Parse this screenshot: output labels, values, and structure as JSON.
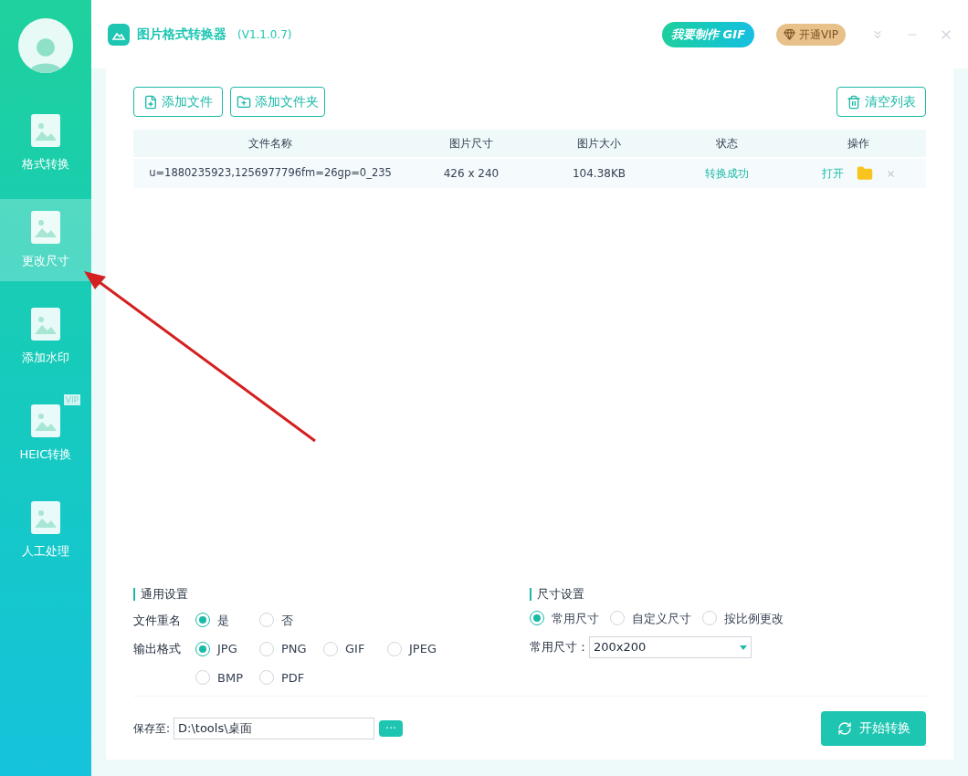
{
  "app": {
    "title": "图片格式转换器",
    "version": "(V1.1.0.7)"
  },
  "header": {
    "gif_button": "我要制作 GIF",
    "vip_button": "开通VIP"
  },
  "sidebar": {
    "items": [
      {
        "label": "格式转换",
        "selected": false
      },
      {
        "label": "更改尺寸",
        "selected": true
      },
      {
        "label": "添加水印",
        "selected": false
      },
      {
        "label": "HEIC转换",
        "selected": false,
        "badge": "VIP"
      },
      {
        "label": "人工处理",
        "selected": false
      }
    ]
  },
  "toolbar": {
    "add_file": "添加文件",
    "add_folder": "添加文件夹",
    "clear": "清空列表"
  },
  "table": {
    "columns": [
      "文件名称",
      "图片尺寸",
      "图片大小",
      "状态",
      "操作"
    ],
    "rows": [
      {
        "name": "u=1880235923,1256977796fm=26gp=0_235",
        "size": "426 x 240",
        "filesize": "104.38KB",
        "status": "转换成功",
        "open": "打开"
      }
    ]
  },
  "general_settings": {
    "title": "通用设置",
    "rename": {
      "label": "文件重名",
      "options": [
        {
          "label": "是",
          "selected": true
        },
        {
          "label": "否",
          "selected": false
        }
      ]
    },
    "format": {
      "label": "输出格式",
      "options": [
        {
          "label": "JPG",
          "selected": true
        },
        {
          "label": "PNG",
          "selected": false
        },
        {
          "label": "GIF",
          "selected": false
        },
        {
          "label": "JPEG",
          "selected": false
        },
        {
          "label": "BMP",
          "selected": false
        },
        {
          "label": "PDF",
          "selected": false
        }
      ]
    }
  },
  "size_settings": {
    "title": "尺寸设置",
    "modes": [
      {
        "label": "常用尺寸",
        "selected": true
      },
      {
        "label": "自定义尺寸",
        "selected": false
      },
      {
        "label": "按比例更改",
        "selected": false
      }
    ],
    "common_size": {
      "label": "常用尺寸：",
      "value": "200x200"
    }
  },
  "save": {
    "label": "保存至:",
    "path": "D:\\tools\\桌面",
    "browse": "···"
  },
  "start_button": "开始转换"
}
